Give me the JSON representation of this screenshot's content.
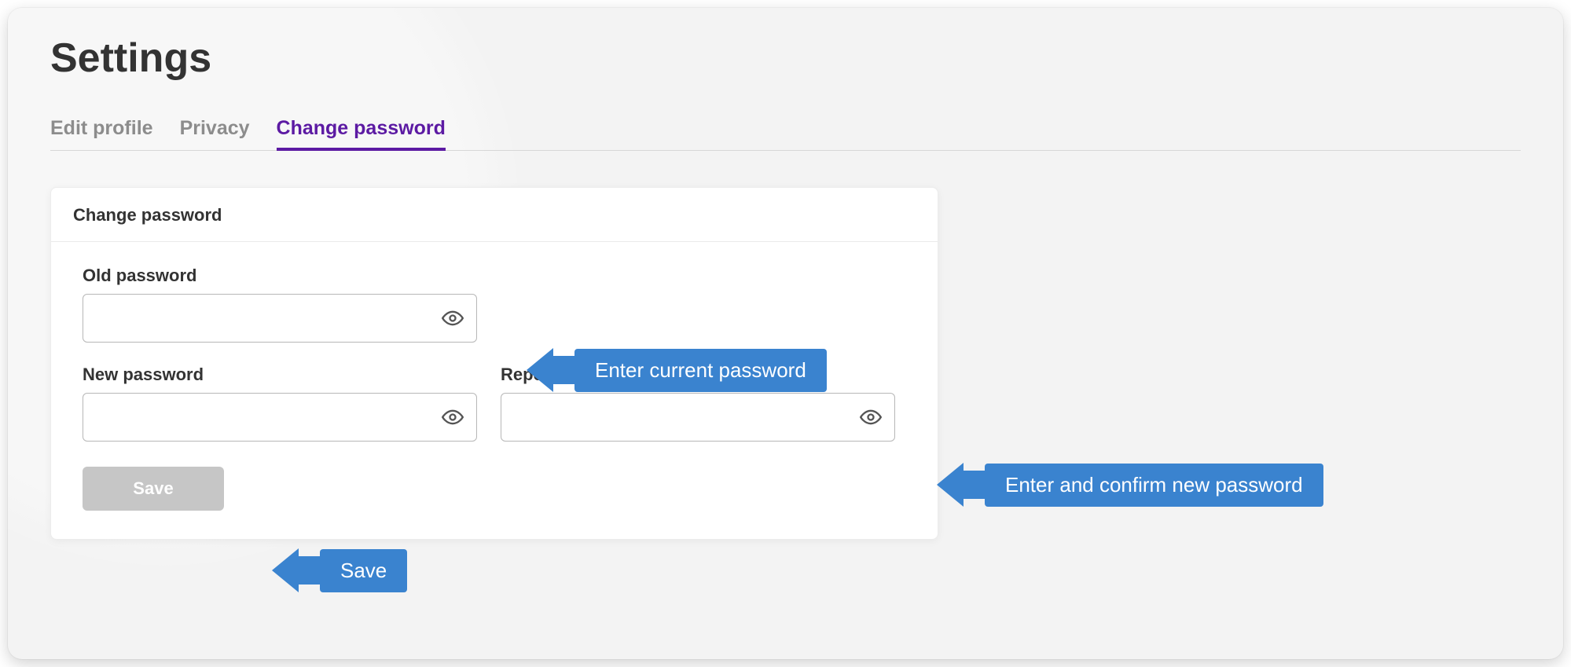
{
  "page": {
    "title": "Settings"
  },
  "tabs": {
    "edit_profile": "Edit profile",
    "privacy": "Privacy",
    "change_password": "Change password",
    "active": "change_password"
  },
  "card": {
    "title": "Change password",
    "fields": {
      "old_password": {
        "label": "Old password",
        "value": ""
      },
      "new_password": {
        "label": "New password",
        "value": ""
      },
      "repeat_password": {
        "label": "Repeat new password",
        "value": ""
      }
    },
    "save_label": "Save"
  },
  "callouts": {
    "current": "Enter current password",
    "new": "Enter and confirm new password",
    "save": "Save"
  },
  "icons": {
    "eye": "eye-icon"
  },
  "colors": {
    "accent": "#5c1aa3",
    "callout": "#3a83cf",
    "bg": "#f3f3f3",
    "save_disabled": "#c6c6c6"
  }
}
